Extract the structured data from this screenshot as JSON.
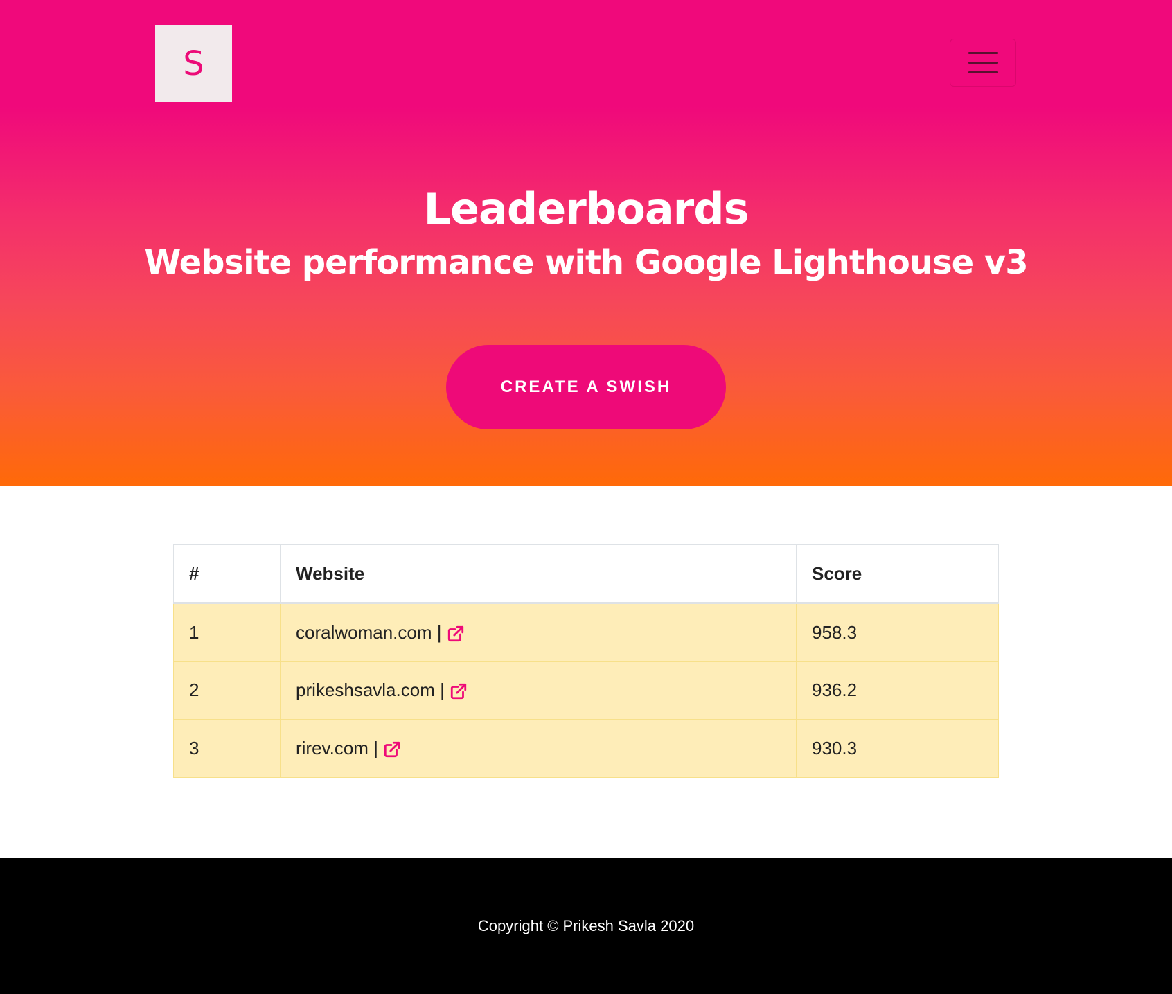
{
  "brand": {
    "logo_letter": "S",
    "accent_color": "#ee0a78"
  },
  "nav": {
    "menu_icon": "hamburger-icon"
  },
  "hero": {
    "title": "Leaderboards",
    "subtitle": "Website performance with Google Lighthouse v3",
    "cta_label": "CREATE A SWISH"
  },
  "table": {
    "headers": [
      "#",
      "Website",
      "Score"
    ],
    "rows": [
      {
        "rank": "1",
        "website": "coralwoman.com |",
        "score": "958.3",
        "link_icon": "external-link-icon"
      },
      {
        "rank": "2",
        "website": "prikeshsavla.com |",
        "score": "936.2",
        "link_icon": "external-link-icon"
      },
      {
        "rank": "3",
        "website": "rirev.com |",
        "score": "930.3",
        "link_icon": "external-link-icon"
      }
    ]
  },
  "footer": {
    "copyright": "Copyright © Prikesh Savla 2020"
  }
}
